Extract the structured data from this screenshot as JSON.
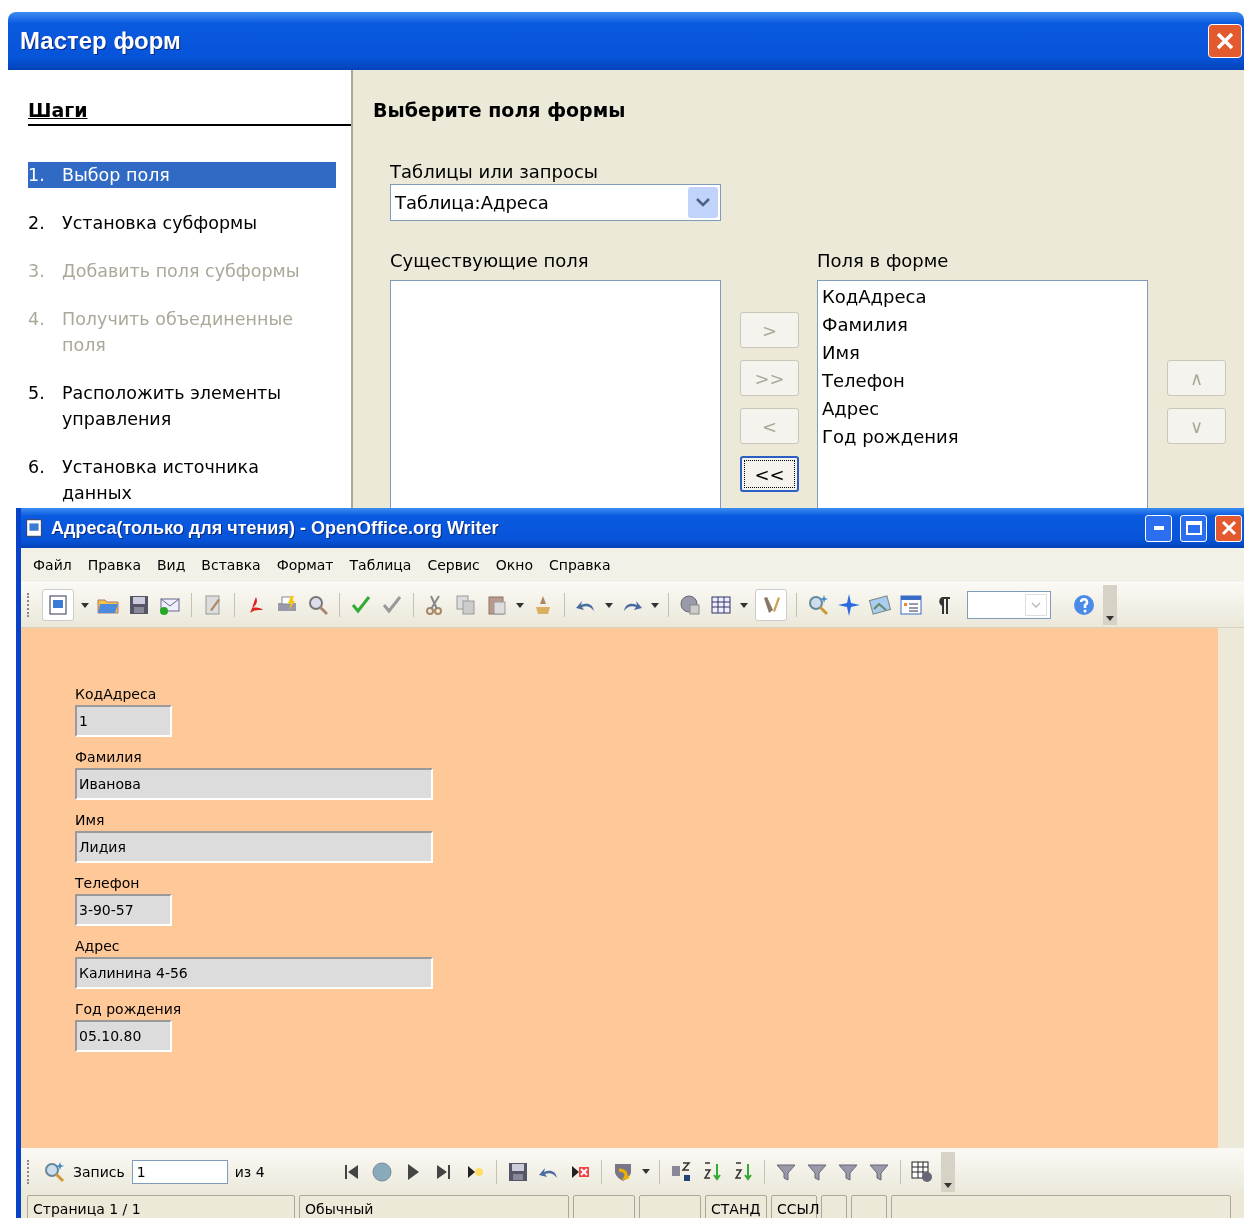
{
  "wizard": {
    "title": "Мастер форм",
    "steps_heading": "Шаги",
    "steps": [
      {
        "number": "1.",
        "label": "Выбор поля",
        "selected": true,
        "disabled": false
      },
      {
        "number": "2.",
        "label": "Установка субформы",
        "selected": false,
        "disabled": false
      },
      {
        "number": "3.",
        "label": "Добавить поля субформы",
        "selected": false,
        "disabled": true
      },
      {
        "number": "4.",
        "label": "Получить объединенные поля",
        "selected": false,
        "disabled": true
      },
      {
        "number": "5.",
        "label": "Расположить элементы управления",
        "selected": false,
        "disabled": false
      },
      {
        "number": "6.",
        "label": "Установка источника данных",
        "selected": false,
        "disabled": false
      }
    ],
    "heading": "Выберите поля формы",
    "table_label": "Таблицы или запросы",
    "table_select": {
      "value": "Таблица:Адреса"
    },
    "available_label": "Существующие поля",
    "selected_label": "Поля в форме",
    "selected_fields": [
      "КодАдреса",
      "Фамилия",
      "Имя",
      "Телефон",
      "Адрес",
      "Год рождения"
    ],
    "move_buttons": [
      {
        "label": ">",
        "disabled": true
      },
      {
        "label": ">>",
        "disabled": true
      },
      {
        "label": "<",
        "disabled": true
      },
      {
        "label": "<<",
        "disabled": false
      }
    ],
    "order_buttons": [
      {
        "label": "∧",
        "disabled": true
      },
      {
        "label": "∨",
        "disabled": true
      }
    ]
  },
  "writer": {
    "title": "Адреса(только для чтения) - OpenOffice.org Writer",
    "menu": [
      "Файл",
      "Правка",
      "Вид",
      "Вставка",
      "Формат",
      "Таблица",
      "Сервис",
      "Окно",
      "Справка"
    ],
    "form_fields": [
      {
        "label": "КодАдреса",
        "value": "1",
        "kind": "short"
      },
      {
        "label": "Фамилия",
        "value": "Иванова",
        "kind": "long"
      },
      {
        "label": "Имя",
        "value": "Лидия",
        "kind": "long"
      },
      {
        "label": "Телефон",
        "value": "3-90-57",
        "kind": "short"
      },
      {
        "label": "Адрес",
        "value": "Калинина 4-56",
        "kind": "long"
      },
      {
        "label": "Год рождения",
        "value": "05.10.80",
        "kind": "short"
      }
    ],
    "record_navigator": {
      "label": "Запись",
      "value": "1",
      "total": "из  4"
    },
    "status_bar": [
      "Страница  1 / 1",
      "Обычный",
      "СТАНД",
      "ССЫЛ"
    ]
  }
}
